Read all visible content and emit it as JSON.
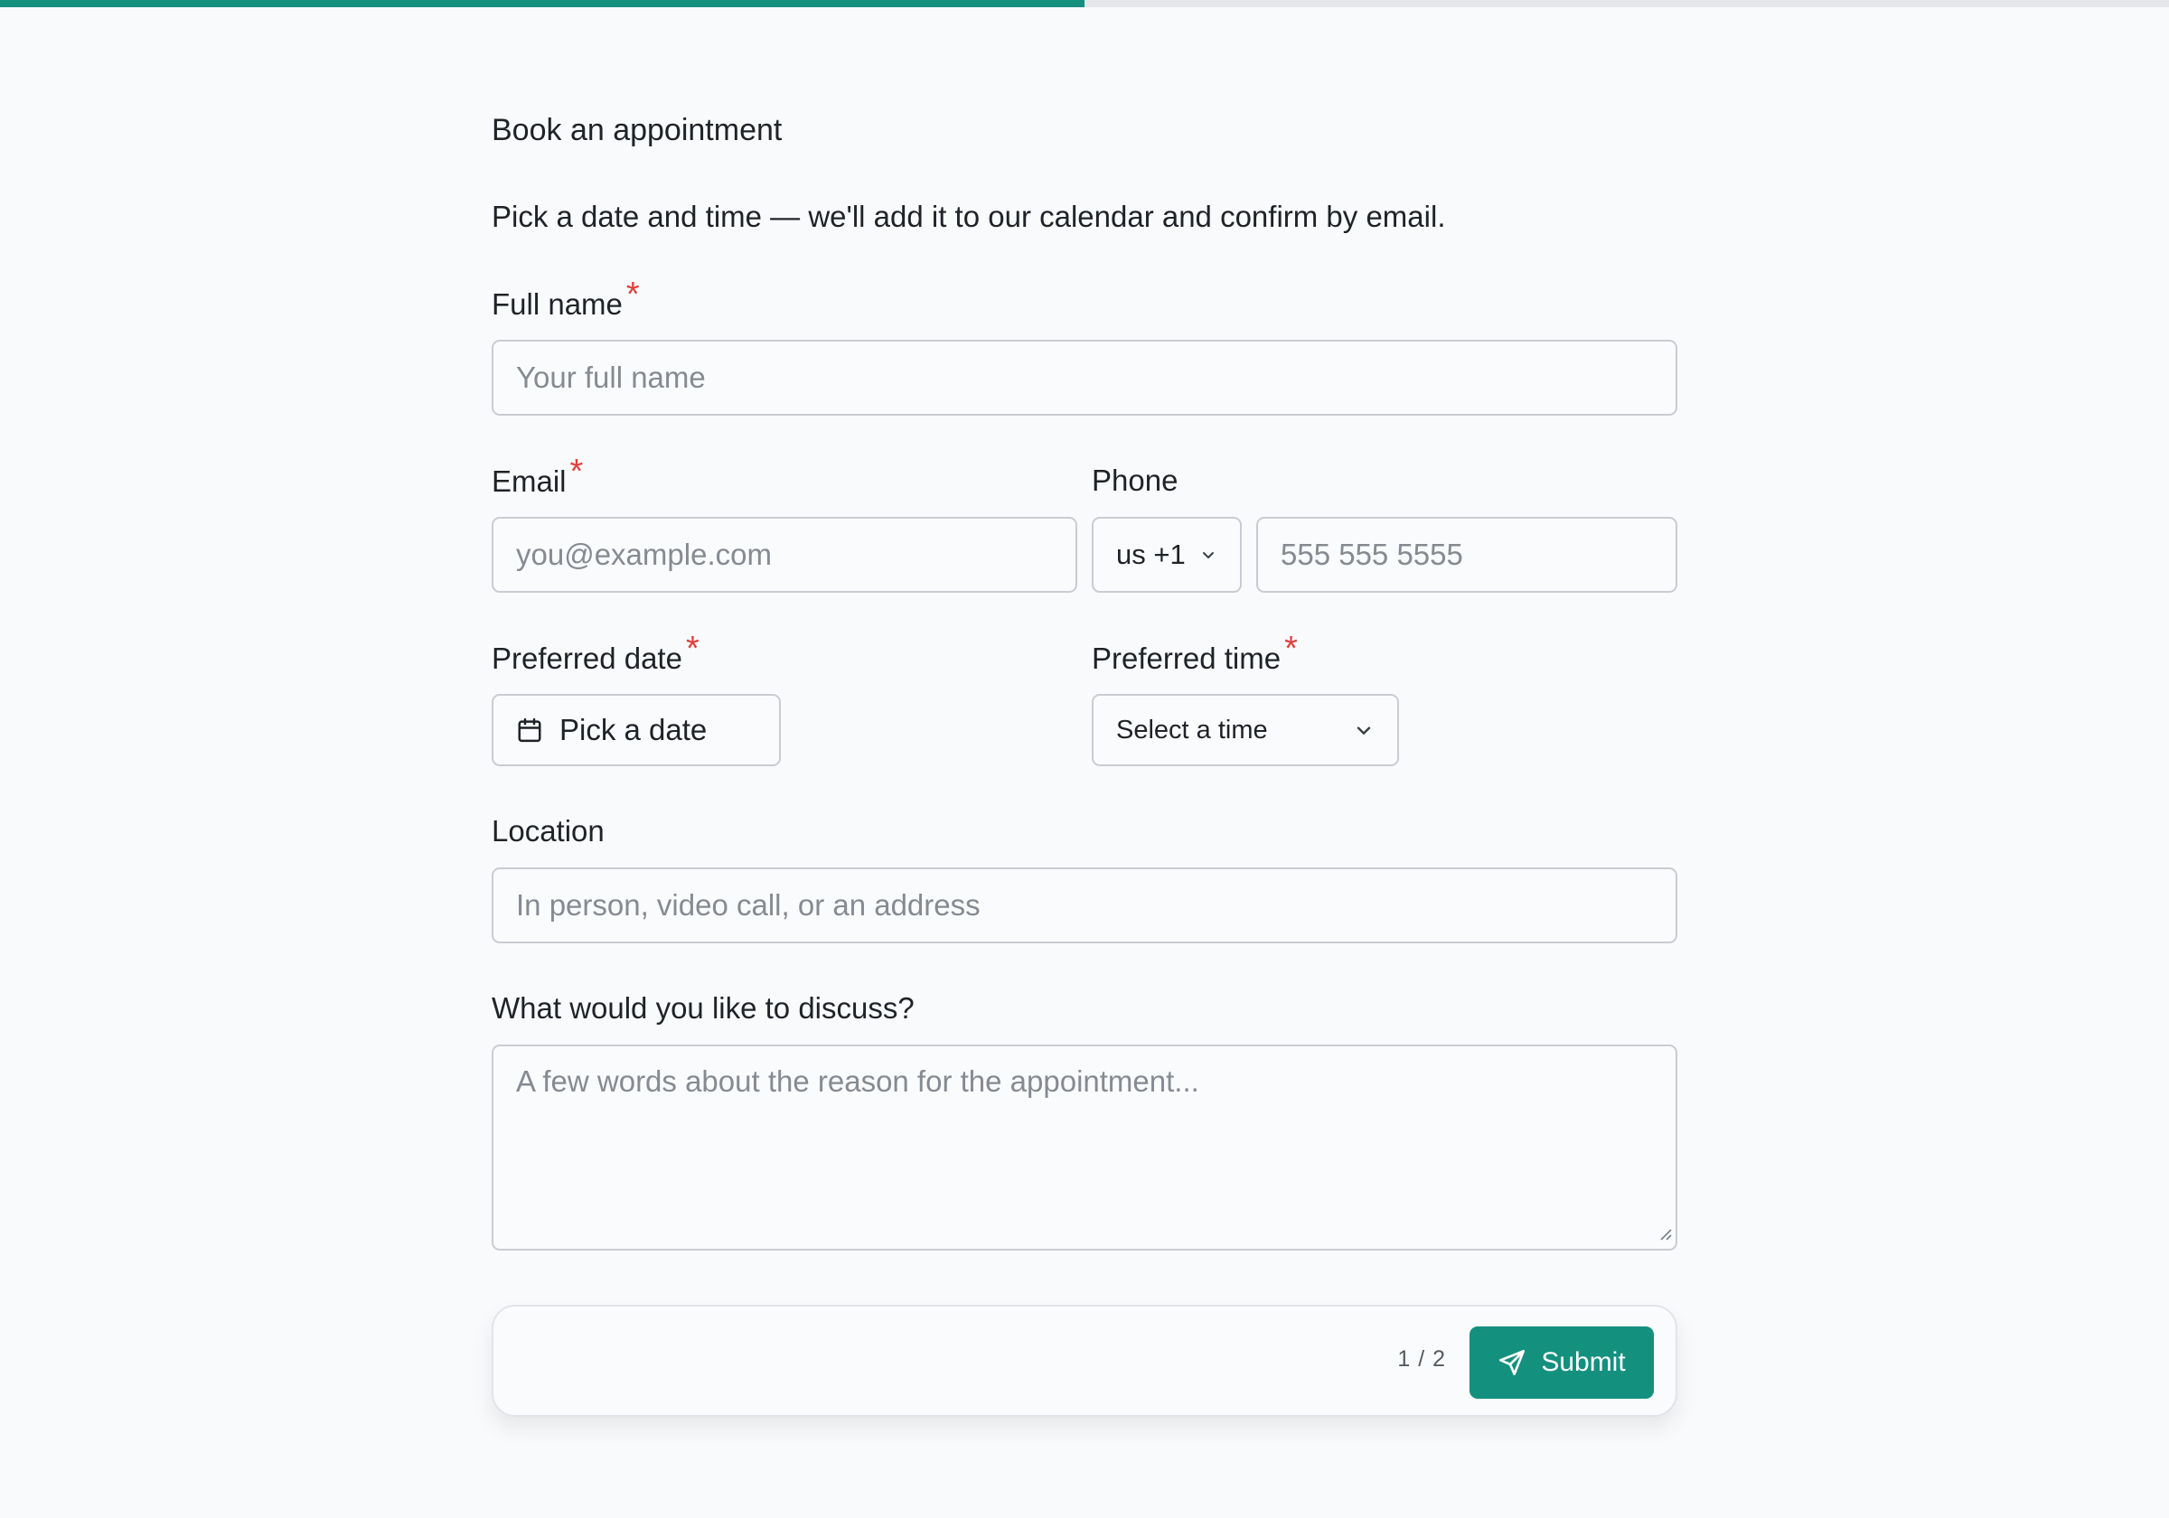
{
  "progress": {
    "fraction": 0.5
  },
  "colors": {
    "accent": "#14907f",
    "required": "#e0403c",
    "placeholder": "#868a91"
  },
  "form": {
    "title": "Book an appointment",
    "subtitle": "Pick a date and time — we'll add it to our calendar and confirm by email.",
    "required_marker": "*",
    "full_name": {
      "label": "Full name",
      "placeholder": "Your full name"
    },
    "email": {
      "label": "Email",
      "placeholder": "you@example.com"
    },
    "phone": {
      "label": "Phone",
      "country_code": "us +1",
      "placeholder": "555 555 5555"
    },
    "preferred_date": {
      "label": "Preferred date",
      "button": "Pick a date",
      "icon": "calendar-icon"
    },
    "preferred_time": {
      "label": "Preferred time",
      "placeholder": "Select a time"
    },
    "location": {
      "label": "Location",
      "placeholder": "In person, video call, or an address"
    },
    "discuss": {
      "label": "What would you like to discuss?",
      "placeholder": "A few words about the reason for the appointment..."
    }
  },
  "footer": {
    "page_indicator": "1 / 2",
    "submit_label": "Submit",
    "submit_icon": "send-icon"
  }
}
